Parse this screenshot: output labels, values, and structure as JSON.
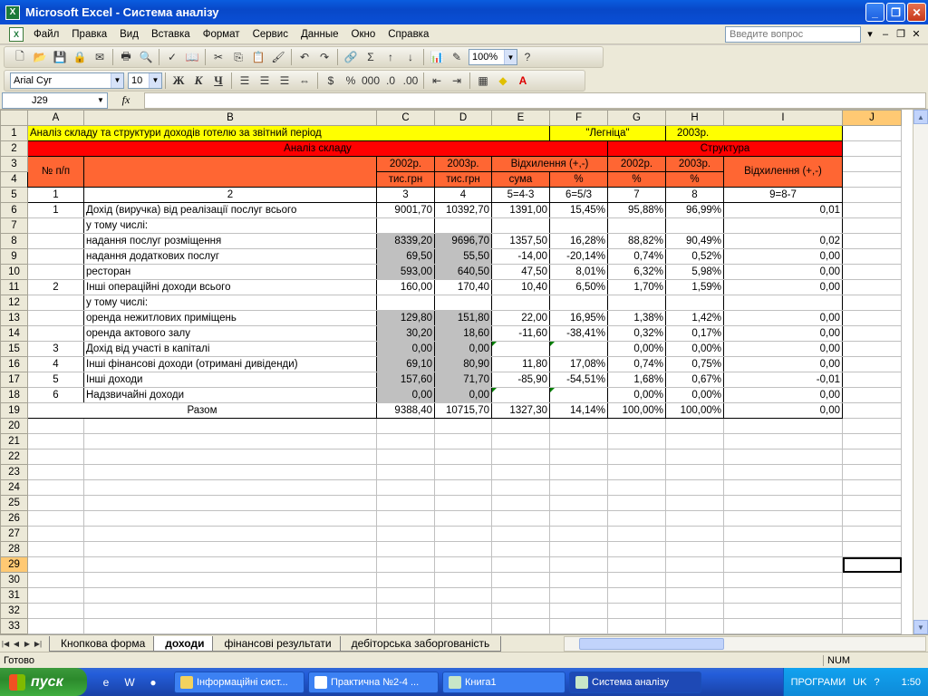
{
  "window": {
    "title": "Microsoft Excel - Система аналізу",
    "app_icon": "excel-icon"
  },
  "menu": {
    "items": [
      "Файл",
      "Правка",
      "Вид",
      "Вставка",
      "Формат",
      "Сервис",
      "Данные",
      "Окно",
      "Справка"
    ],
    "ask_placeholder": "Введите вопрос"
  },
  "toolbar": {
    "zoom": "100%",
    "font": "Arial Cyr",
    "size": "10",
    "bold": "Ж",
    "italic": "К",
    "underline": "Ч"
  },
  "formula_bar": {
    "name_box": "J29",
    "fx": "fx",
    "content": ""
  },
  "columns": [
    "A",
    "B",
    "C",
    "D",
    "E",
    "F",
    "G",
    "H",
    "I",
    "J"
  ],
  "row_numbers": [
    "1",
    "2",
    "3",
    "4",
    "5",
    "6",
    "7",
    "8",
    "9",
    "10",
    "11",
    "12",
    "13",
    "14",
    "15",
    "16",
    "17",
    "18",
    "19",
    "20",
    "21",
    "22",
    "23",
    "24",
    "25",
    "26",
    "27",
    "28",
    "29",
    "30",
    "31",
    "32",
    "33"
  ],
  "sheet": {
    "title": "Аналіз складу та структури доходів готелю за звітний період",
    "hotel": "\"Легніца\"",
    "year": "2003р.",
    "section_composition": "Аналіз складу",
    "section_structure": "Структура",
    "h_num": "№ п/п",
    "h_2002": "2002р.",
    "h_2003": "2003р.",
    "h_dev": "Відхилення (+,-)",
    "h_2002s": "2002р.",
    "h_2003s": "2003р.",
    "h_devs": "Відхилення (+,-)",
    "u_c": "тис.грн",
    "u_d": "тис.грн",
    "u_e": "сума",
    "u_f": "%",
    "u_g": "%",
    "u_h": "%",
    "idx": [
      "1",
      "2",
      "3",
      "4",
      "5=4-3",
      "6=5/3",
      "7",
      "8",
      "9=8-7"
    ],
    "rows": [
      {
        "a": "1",
        "b": "Дохід (виручка) від реалізації послуг всього",
        "c": "9001,70",
        "d": "10392,70",
        "e": "1391,00",
        "f": "15,45%",
        "g": "95,88%",
        "h": "96,99%",
        "i": "0,01"
      },
      {
        "a": "",
        "b": "у тому числі:",
        "c": "",
        "d": "",
        "e": "",
        "f": "",
        "g": "",
        "h": "",
        "i": ""
      },
      {
        "a": "",
        "b": "надання послуг розміщення",
        "c": "8339,20",
        "d": "9696,70",
        "e": "1357,50",
        "f": "16,28%",
        "g": "88,82%",
        "h": "90,49%",
        "i": "0,02"
      },
      {
        "a": "",
        "b": "надання додаткових послуг",
        "c": "69,50",
        "d": "55,50",
        "e": "-14,00",
        "f": "-20,14%",
        "g": "0,74%",
        "h": "0,52%",
        "i": "0,00"
      },
      {
        "a": "",
        "b": "ресторан",
        "c": "593,00",
        "d": "640,50",
        "e": "47,50",
        "f": "8,01%",
        "g": "6,32%",
        "h": "5,98%",
        "i": "0,00"
      },
      {
        "a": "2",
        "b": "Інші операційні доходи всього",
        "c": "160,00",
        "d": "170,40",
        "e": "10,40",
        "f": "6,50%",
        "g": "1,70%",
        "h": "1,59%",
        "i": "0,00"
      },
      {
        "a": "",
        "b": "у тому числі:",
        "c": "",
        "d": "",
        "e": "",
        "f": "",
        "g": "",
        "h": "",
        "i": ""
      },
      {
        "a": "",
        "b": "оренда нежитлових приміщень",
        "c": "129,80",
        "d": "151,80",
        "e": "22,00",
        "f": "16,95%",
        "g": "1,38%",
        "h": "1,42%",
        "i": "0,00"
      },
      {
        "a": "",
        "b": "оренда актового залу",
        "c": "30,20",
        "d": "18,60",
        "e": "-11,60",
        "f": "-38,41%",
        "g": "0,32%",
        "h": "0,17%",
        "i": "0,00"
      },
      {
        "a": "3",
        "b": "Дохід від участі в капіталі",
        "c": "0,00",
        "d": "0,00",
        "e": "",
        "f": "",
        "g": "0,00%",
        "h": "0,00%",
        "i": "0,00"
      },
      {
        "a": "4",
        "b": "Інші фінансові доходи (отримані дивіденди)",
        "c": "69,10",
        "d": "80,90",
        "e": "11,80",
        "f": "17,08%",
        "g": "0,74%",
        "h": "0,75%",
        "i": "0,00"
      },
      {
        "a": "5",
        "b": "Інші доходи",
        "c": "157,60",
        "d": "71,70",
        "e": "-85,90",
        "f": "-54,51%",
        "g": "1,68%",
        "h": "0,67%",
        "i": "-0,01"
      },
      {
        "a": "6",
        "b": "Надзвичайні доходи",
        "c": "0,00",
        "d": "0,00",
        "e": "",
        "f": "",
        "g": "0,00%",
        "h": "0,00%",
        "i": "0,00"
      }
    ],
    "total": {
      "b": "Разом",
      "c": "9388,40",
      "d": "10715,70",
      "e": "1327,30",
      "f": "14,14%",
      "g": "100,00%",
      "h": "100,00%",
      "i": "0,00"
    }
  },
  "tabs": [
    "Кнопкова форма",
    "доходи",
    "фінансові результати",
    "дебіторська заборгованість"
  ],
  "active_tab": "доходи",
  "status": {
    "left": "Готово",
    "num": "NUM"
  },
  "taskbar": {
    "start": "пуск",
    "items": [
      "Інформаційні сист...",
      "Практична №2-4 ...",
      "Книга1",
      "Система аналізу"
    ],
    "lang_label": "ПРОГРАМИ",
    "lang": "UK",
    "clock": "1:50"
  }
}
